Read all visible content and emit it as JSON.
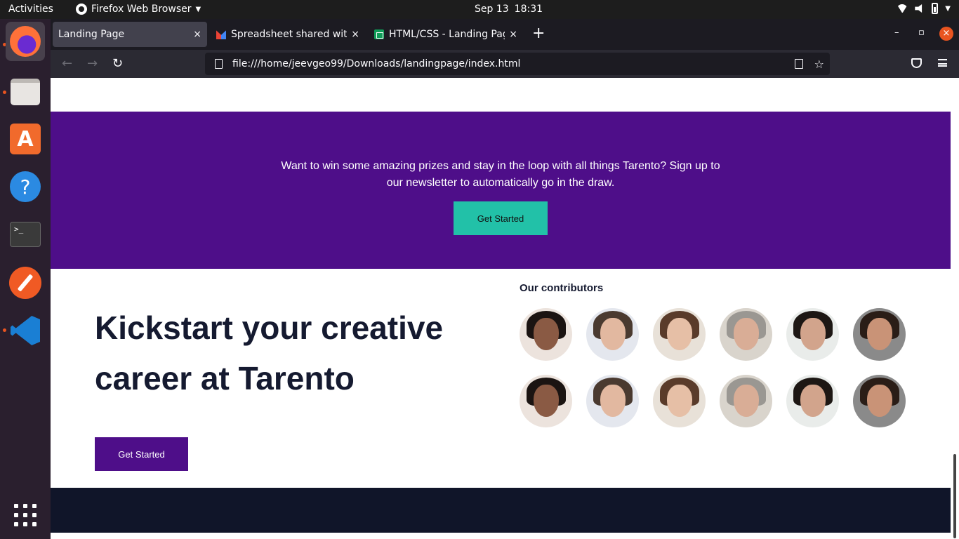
{
  "system": {
    "activities": "Activities",
    "app_name": "Firefox Web Browser",
    "date": "Sep 13",
    "time": "18:31"
  },
  "dock": {
    "apps": [
      "firefox-icon",
      "files-icon",
      "software-store-icon",
      "help-icon",
      "terminal-icon",
      "postman-icon",
      "vscode-icon",
      "app-grid-icon"
    ],
    "terminal_glyph": ">_",
    "help_glyph": "?",
    "store_glyph": "A"
  },
  "browser": {
    "tabs": [
      {
        "label": "Landing Page",
        "active": true
      },
      {
        "label": "Spreadsheet shared with",
        "active": false
      },
      {
        "label": "HTML/CSS - Landing Page",
        "active": false
      }
    ],
    "tab_close": "×",
    "new_tab": "+",
    "url": "file:///home/jeevgeo99/Downloads/landingpage/index.html",
    "back": "←",
    "forward": "→",
    "reload": "↻",
    "bookmark": "☆",
    "minimize": "–",
    "restore": "▫",
    "close": "×"
  },
  "page": {
    "promo": {
      "text": "Want to win some amazing prizes and stay in the loop with all things Tarento? Sign up to our newsletter to automatically go in the draw.",
      "button": "Get Started"
    },
    "hero": {
      "title": "Kickstart your creative career at Tarento",
      "button": "Get Started"
    },
    "contributors": {
      "title": "Our contributors",
      "avatars": [
        {
          "bg": "#ece3dd",
          "skin": "#8a5a44",
          "hair": "#1b1412"
        },
        {
          "bg": "#e4e7ee",
          "skin": "#e2b8a0",
          "hair": "#4a3a30"
        },
        {
          "bg": "#e8e1d8",
          "skin": "#e6bfa6",
          "hair": "#5a3b2a"
        },
        {
          "bg": "#d9d4cc",
          "skin": "#d9ad96",
          "hair": "#9a9792"
        },
        {
          "bg": "#e9ecea",
          "skin": "#d2a48c",
          "hair": "#1d1714"
        },
        {
          "bg": "#8a8a8a",
          "skin": "#c99377",
          "hair": "#2a1d17"
        },
        {
          "bg": "#ece3dd",
          "skin": "#8a5a44",
          "hair": "#1b1412"
        },
        {
          "bg": "#e4e7ee",
          "skin": "#e2b8a0",
          "hair": "#4a3a30"
        },
        {
          "bg": "#e8e1d8",
          "skin": "#e6bfa6",
          "hair": "#5a3b2a"
        },
        {
          "bg": "#d9d4cc",
          "skin": "#d9ad96",
          "hair": "#9a9792"
        },
        {
          "bg": "#e9ecea",
          "skin": "#d2a48c",
          "hair": "#1d1714"
        },
        {
          "bg": "#8a8a8a",
          "skin": "#c99377",
          "hair": "#2a1d17"
        }
      ]
    }
  },
  "colors": {
    "promo_bg": "#4e0e89",
    "promo_button": "#22c1a8",
    "hero_button": "#4e0e89",
    "footer_bg": "#101529"
  }
}
